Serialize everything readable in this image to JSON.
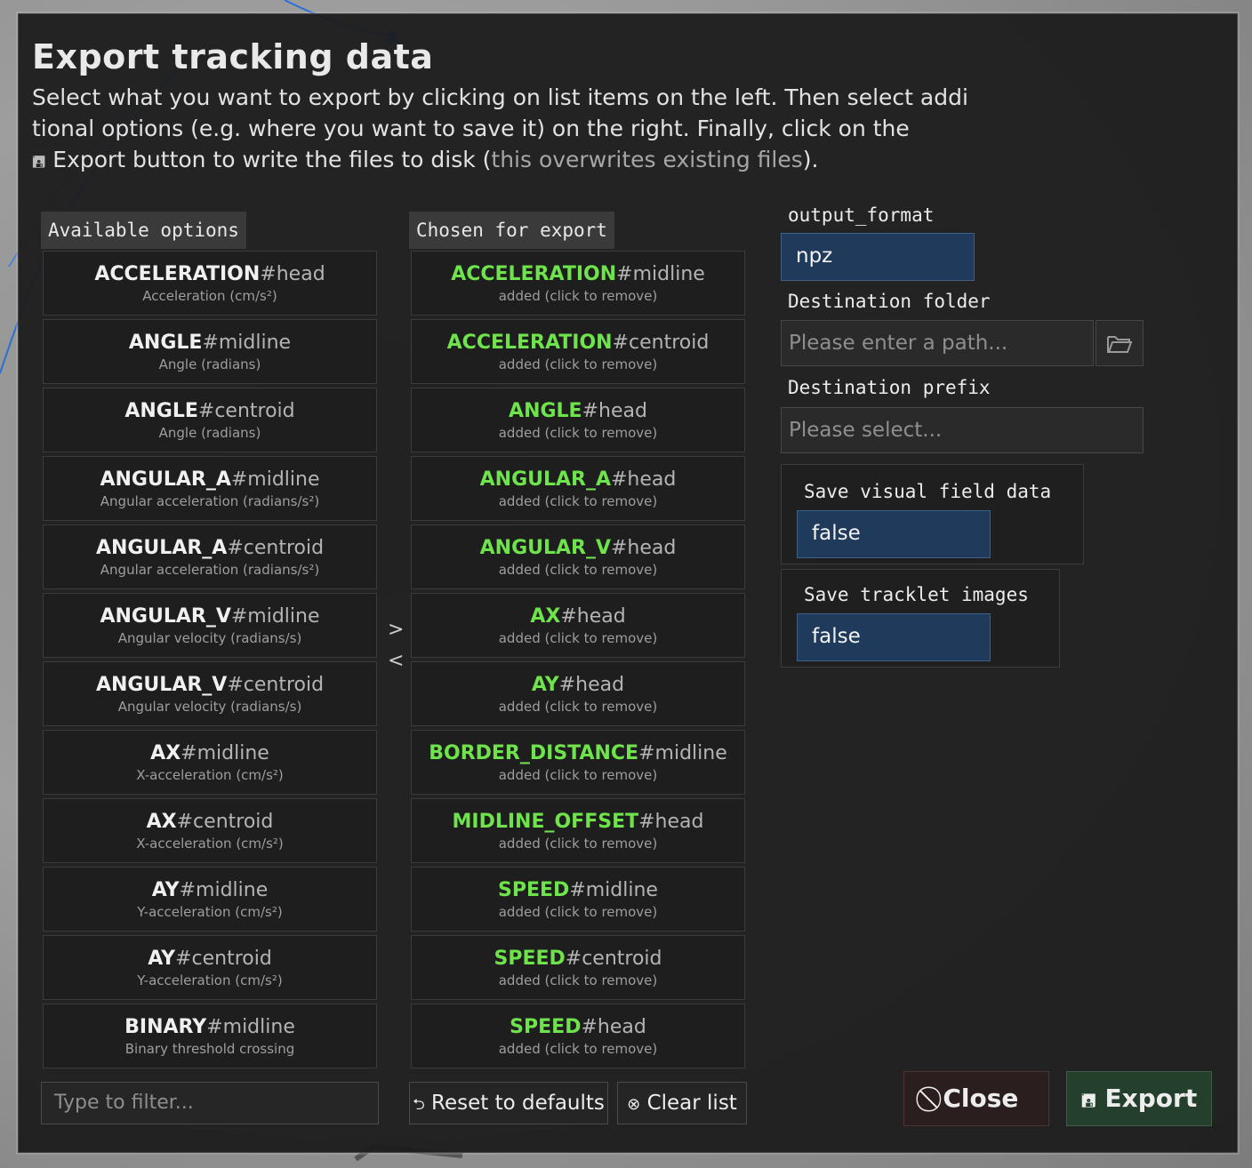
{
  "dialog": {
    "title": "Export tracking data",
    "description_part1": "Select what you want to export by clicking on list items on the left. Then select addi tional options (e.g. where you want to save it) on the right. Finally, click on the ",
    "description_export": " Export button to write the files to disk (",
    "description_muted": "this overwrites existing files",
    "description_end": ")."
  },
  "available": {
    "label": "Available options",
    "items": [
      {
        "name": "ACCELERATION",
        "suffix": "#head",
        "desc": "Acceleration (cm/s²)"
      },
      {
        "name": "ANGLE",
        "suffix": "#midline",
        "desc": "Angle (radians)"
      },
      {
        "name": "ANGLE",
        "suffix": "#centroid",
        "desc": "Angle (radians)"
      },
      {
        "name": "ANGULAR_A",
        "suffix": "#midline",
        "desc": "Angular acceleration (radians/s²)"
      },
      {
        "name": "ANGULAR_A",
        "suffix": "#centroid",
        "desc": "Angular acceleration (radians/s²)"
      },
      {
        "name": "ANGULAR_V",
        "suffix": "#midline",
        "desc": "Angular velocity (radians/s)"
      },
      {
        "name": "ANGULAR_V",
        "suffix": "#centroid",
        "desc": "Angular velocity (radians/s)"
      },
      {
        "name": "AX",
        "suffix": "#midline",
        "desc": "X-acceleration (cm/s²)"
      },
      {
        "name": "AX",
        "suffix": "#centroid",
        "desc": "X-acceleration (cm/s²)"
      },
      {
        "name": "AY",
        "suffix": "#midline",
        "desc": "Y-acceleration (cm/s²)"
      },
      {
        "name": "AY",
        "suffix": "#centroid",
        "desc": "Y-acceleration (cm/s²)"
      },
      {
        "name": "BINARY",
        "suffix": "#midline",
        "desc": "Binary threshold crossing"
      }
    ],
    "filter_placeholder": "Type to filter..."
  },
  "chosen": {
    "label": "Chosen for export",
    "hint": "added (click to remove)",
    "items": [
      {
        "name": "ACCELERATION",
        "suffix": "#midline"
      },
      {
        "name": "ACCELERATION",
        "suffix": "#centroid"
      },
      {
        "name": "ANGLE",
        "suffix": "#head"
      },
      {
        "name": "ANGULAR_A",
        "suffix": "#head"
      },
      {
        "name": "ANGULAR_V",
        "suffix": "#head"
      },
      {
        "name": "AX",
        "suffix": "#head"
      },
      {
        "name": "AY",
        "suffix": "#head"
      },
      {
        "name": "BORDER_DISTANCE",
        "suffix": "#midline"
      },
      {
        "name": "MIDLINE_OFFSET",
        "suffix": "#head"
      },
      {
        "name": "SPEED",
        "suffix": "#midline"
      },
      {
        "name": "SPEED",
        "suffix": "#centroid"
      },
      {
        "name": "SPEED",
        "suffix": "#head"
      }
    ],
    "reset_label": "Reset to defaults",
    "clear_label": "Clear list"
  },
  "arrows": {
    "right": ">",
    "left": "<"
  },
  "options": {
    "output_format_label": "output_format",
    "output_format_value": "npz",
    "dest_folder_label": "Destination folder",
    "dest_folder_placeholder": "Please enter a path...",
    "dest_prefix_label": "Destination prefix",
    "dest_prefix_placeholder": "Please select...",
    "visual_field_label": "Save visual field data",
    "visual_field_value": "false",
    "tracklet_label": "Save tracklet images",
    "tracklet_value": "false"
  },
  "footer": {
    "close_label": "Close",
    "export_label": "Export"
  },
  "colors": {
    "chosen_name": "#6ee34b",
    "option_value_bg": "#203a5c",
    "close_bg": "#2a1e1e",
    "export_bg": "#24402c"
  }
}
